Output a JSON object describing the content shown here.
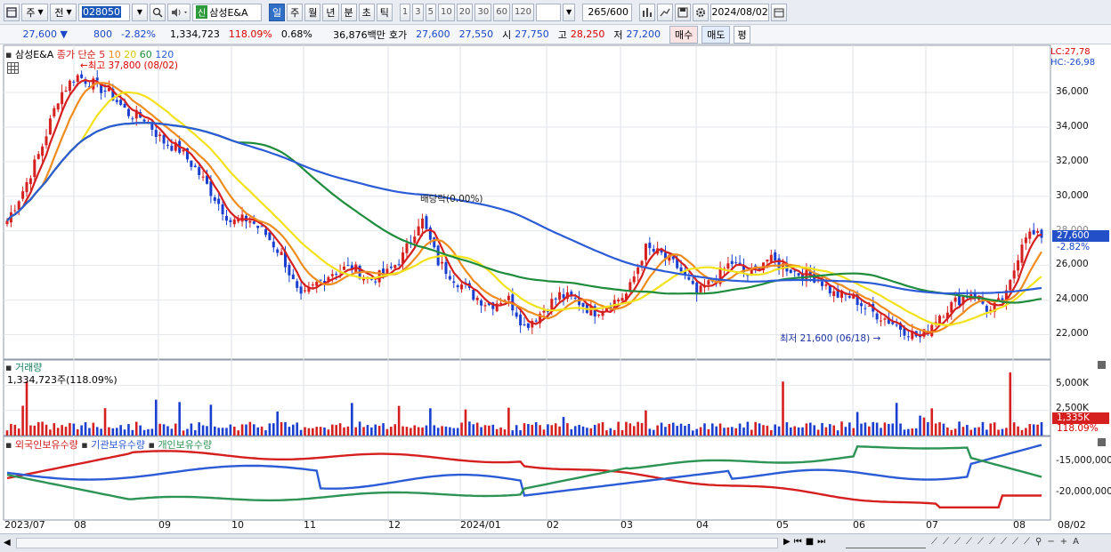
{
  "toolbar": {
    "period_d": "주",
    "prev": "전",
    "code": "028050",
    "badge": "신",
    "name": "삼성E&A",
    "tabs": [
      "일",
      "주",
      "월",
      "년",
      "분",
      "초",
      "틱"
    ],
    "minutes": [
      "1",
      "3",
      "5",
      "10",
      "20",
      "30",
      "60",
      "120"
    ],
    "count": "265",
    "total": "/600",
    "date": "2024/08/02"
  },
  "quote": {
    "price": "27,600",
    "change_arrow": "▼",
    "change": "800",
    "change_pct": "-2.82%",
    "volume": "1,334,723",
    "vol_ratio": "118.09%",
    "turnover": "0.68%",
    "amount": "36,876백만",
    "bid_label": "호가",
    "ask": "27,600",
    "bid": "27,550",
    "open_label": "시",
    "open": "27,750",
    "high_label": "고",
    "high": "28,250",
    "low_label": "저",
    "low": "27,200",
    "buy": "매수",
    "sell": "매도",
    "eval": "평"
  },
  "price_pane": {
    "title": "삼성E&A",
    "legend_prefix": "종가 단순",
    "ma_periods": [
      "5",
      "10",
      "20",
      "60",
      "120"
    ],
    "ma_colors": [
      "#d62020",
      "#f08c1e",
      "#f2e21a",
      "#1e8c3c",
      "#2c5bd6"
    ],
    "lc_label": "LC:27,78",
    "hc_label": "HC:-26,98",
    "max_annot": "최고 37,800 (08/02)",
    "min_annot": "최저 21,600 (06/18)",
    "div_annot": "배당락(0.00%)",
    "last_price": "27,600",
    "last_pct": "-2.82%",
    "yticks": [
      "36,000",
      "34,000",
      "32,000",
      "30,000",
      "28,000",
      "26,000",
      "24,000",
      "22,000"
    ]
  },
  "volume_pane": {
    "title": "거래량",
    "value": "1,334,723주(118.09%)",
    "yticks": [
      "5,000K",
      "2,500K"
    ],
    "last_box": "1,335K",
    "last_pct": "118.09%"
  },
  "holding_pane": {
    "legend": [
      "외국인보유수량",
      "기관보유수량",
      "개인보유수량"
    ],
    "legend_colors": [
      "#d62020",
      "#2c5bd6",
      "#2e9455"
    ],
    "yticks": [
      "-15,000,000",
      "-20,000,000"
    ]
  },
  "xaxis": [
    "2023/07",
    "08",
    "09",
    "10",
    "11",
    "12",
    "2024/01",
    "02",
    "03",
    "04",
    "05",
    "06",
    "07",
    "08"
  ],
  "xaxis_right": "08/02",
  "chart_data": {
    "type": "line",
    "title": "삼성E&A",
    "x_range": [
      "2023/07",
      "2024/08/02"
    ],
    "ylim": [
      21000,
      37800
    ],
    "series": [
      {
        "name": "종가",
        "values": [
          28600,
          30500,
          32800,
          35800,
          37000,
          36500,
          35900,
          34800,
          34500,
          33200,
          32700,
          31500,
          30000,
          28500,
          28700,
          27800,
          26500,
          24000,
          25000,
          25700,
          25900,
          25200,
          25500,
          26600,
          28800,
          26200,
          25200,
          24300,
          23700,
          24200,
          22500,
          23300,
          24300,
          24000,
          23300,
          23800,
          24400,
          27000,
          26600,
          25800,
          24300,
          25200,
          26200,
          25400,
          26400,
          26000,
          25500,
          25300,
          24300,
          24200,
          23400,
          22900,
          22300,
          21800,
          23100,
          23900,
          24500,
          23300,
          24300,
          27900,
          27600
        ]
      }
    ]
  }
}
